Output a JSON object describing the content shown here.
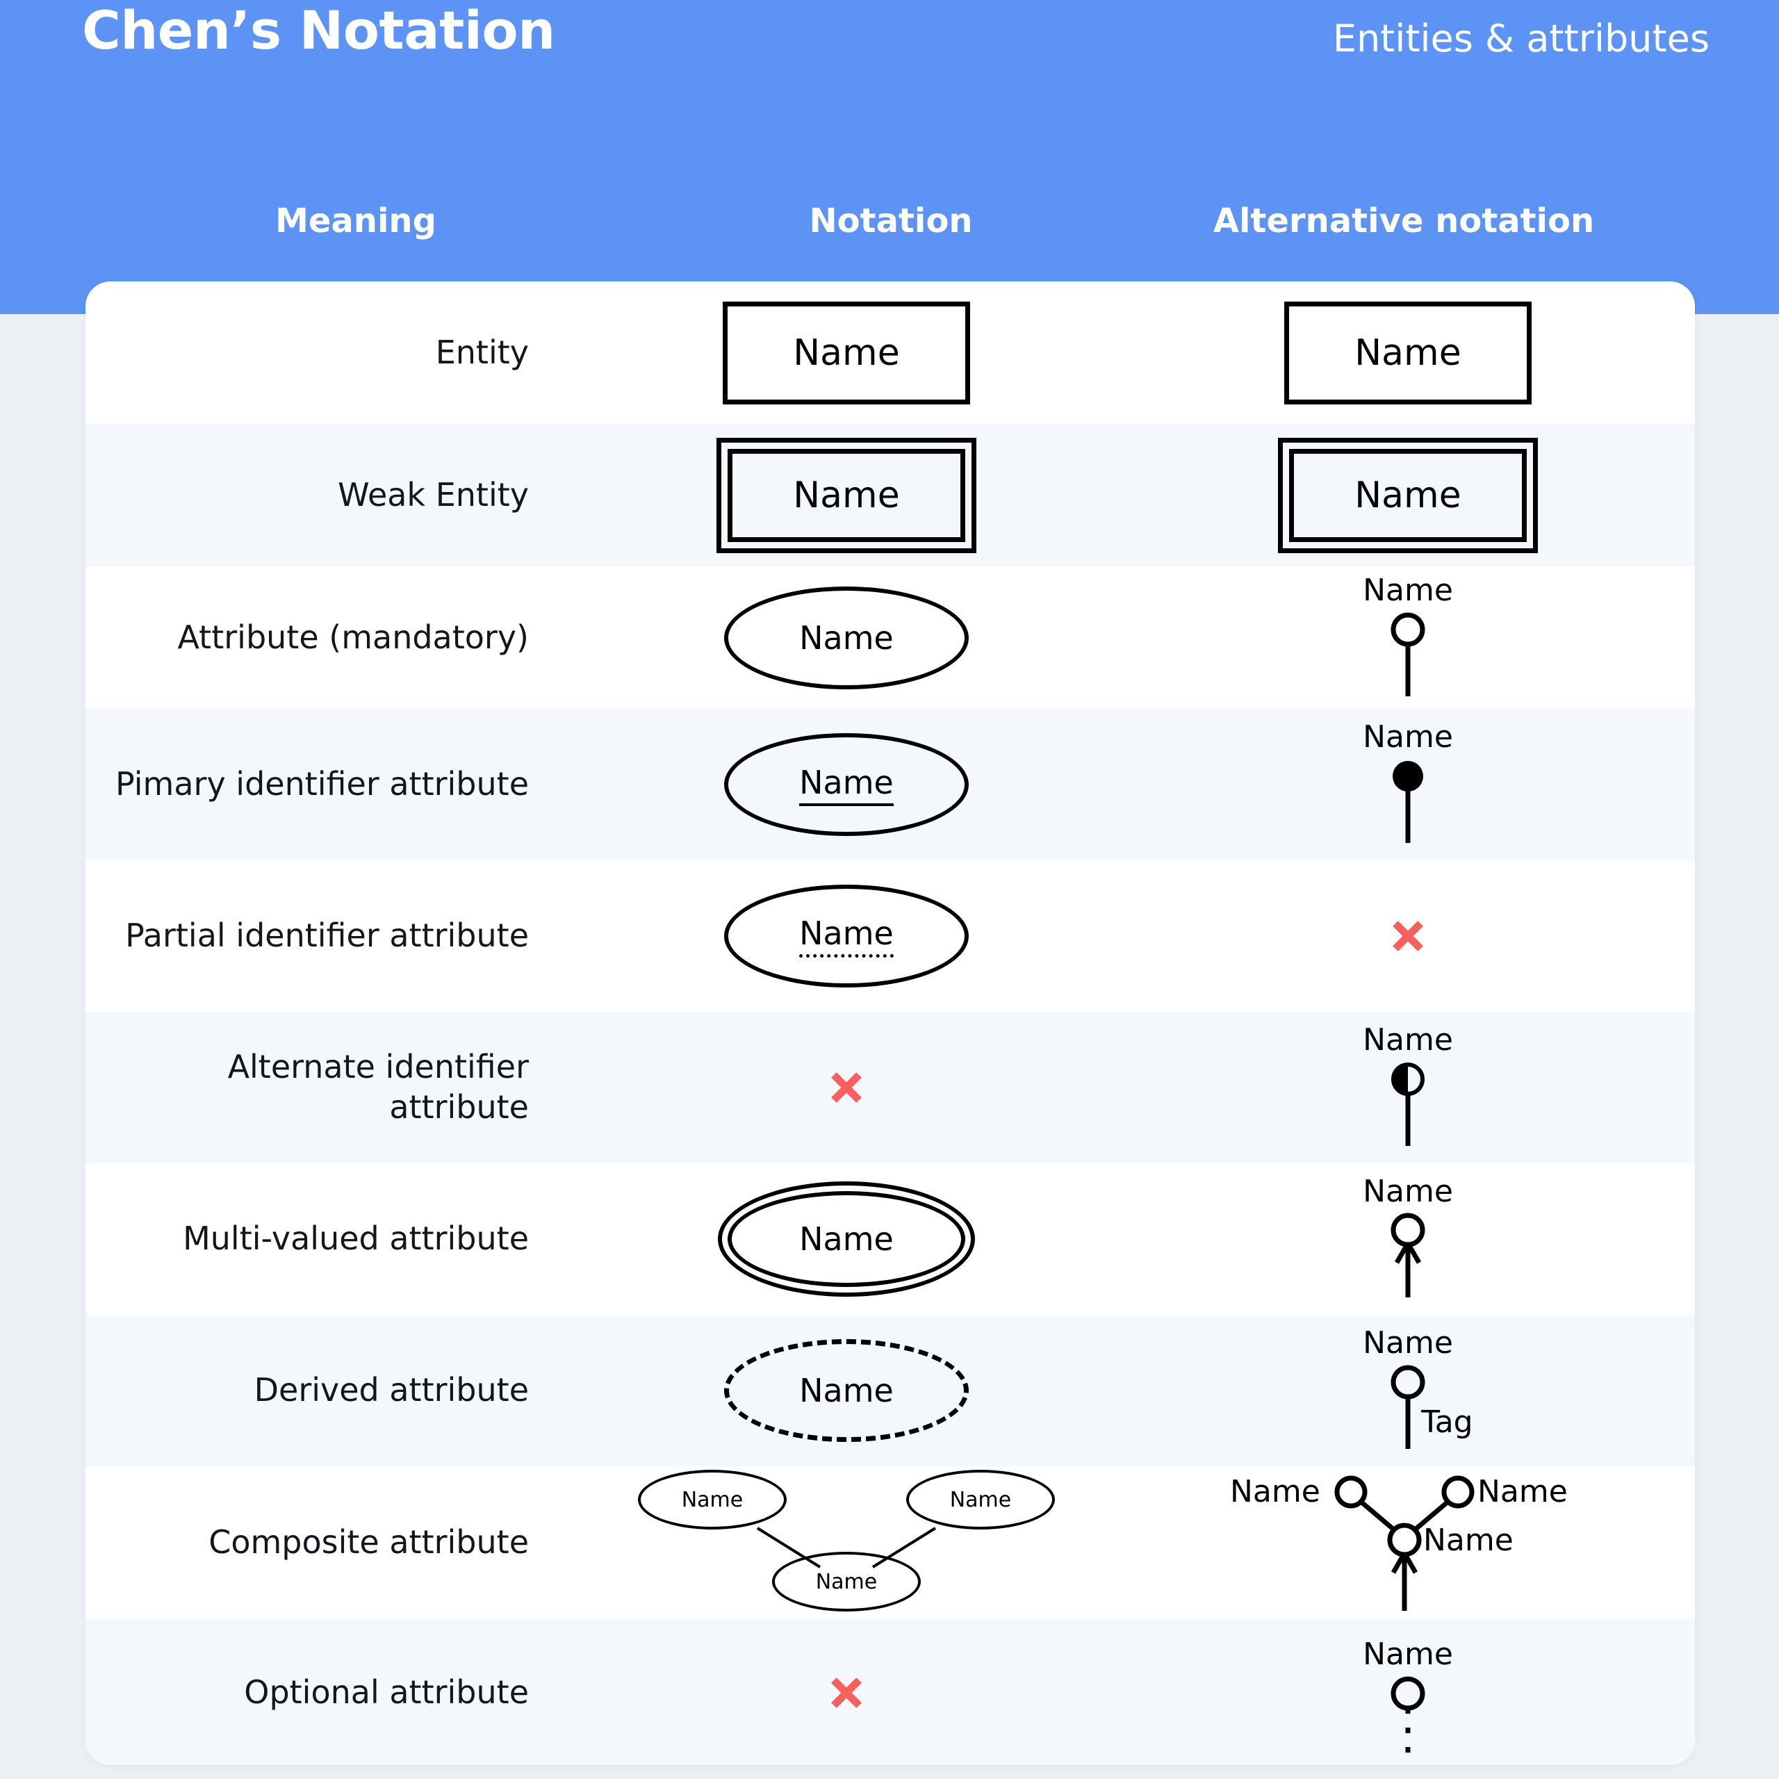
{
  "header": {
    "title": "Chen’s Notation",
    "subtitle": "Entities & attributes",
    "accent_color": "#5C93F5",
    "columns": {
      "meaning": "Meaning",
      "notation": "Notation",
      "alternative": "Alternative notation"
    }
  },
  "palette": {
    "header_blue": "#5C93F5",
    "page_bg": "#ECEFF3",
    "card_bg": "#FFFFFF",
    "row_alt_bg": "#F4F7FC",
    "x_mark_red": "#F85F5F",
    "ink": "#000000"
  },
  "common": {
    "name_label": "Name",
    "tag_label": "Tag",
    "not_available_icon": "x-mark-icon"
  },
  "rows": [
    {
      "meaning": "Entity",
      "notation": {
        "kind": "rectangle",
        "label": "Name"
      },
      "alternative": {
        "kind": "rectangle",
        "label": "Name"
      }
    },
    {
      "meaning": "Weak Entity",
      "notation": {
        "kind": "double-rectangle",
        "label": "Name"
      },
      "alternative": {
        "kind": "double-rectangle",
        "label": "Name"
      }
    },
    {
      "meaning": "Attribute (mandatory)",
      "notation": {
        "kind": "ellipse",
        "label": "Name"
      },
      "alternative": {
        "kind": "pin-hollow-circle",
        "label": "Name"
      }
    },
    {
      "meaning": "Pimary identifier attribute",
      "notation": {
        "kind": "ellipse-underline-solid",
        "label": "Name"
      },
      "alternative": {
        "kind": "pin-filled-circle",
        "label": "Name"
      }
    },
    {
      "meaning": "Partial identifier attribute",
      "notation": {
        "kind": "ellipse-underline-dotted",
        "label": "Name"
      },
      "alternative": {
        "kind": "none",
        "label": ""
      }
    },
    {
      "meaning": "Alternate identifier attribute",
      "notation": {
        "kind": "none",
        "label": ""
      },
      "alternative": {
        "kind": "pin-half-filled-circle",
        "label": "Name"
      }
    },
    {
      "meaning": "Multi-valued attribute",
      "notation": {
        "kind": "double-ellipse",
        "label": "Name"
      },
      "alternative": {
        "kind": "pin-hollow-circle-arrow",
        "label": "Name"
      }
    },
    {
      "meaning": "Derived attribute",
      "notation": {
        "kind": "dashed-ellipse",
        "label": "Name"
      },
      "alternative": {
        "kind": "pin-hollow-circle-tag",
        "label": "Name",
        "tag": "Tag"
      }
    },
    {
      "meaning": "Composite attribute",
      "notation": {
        "kind": "composite-ellipses",
        "top_left_label": "Name",
        "top_right_label": "Name",
        "bottom_label": "Name"
      },
      "alternative": {
        "kind": "composite-circles",
        "left_label": "Name",
        "right_label": "Name",
        "center_label": "Name"
      }
    },
    {
      "meaning": "Optional attribute",
      "notation": {
        "kind": "none",
        "label": ""
      },
      "alternative": {
        "kind": "pin-hollow-circle-dotted-stem",
        "label": "Name"
      }
    }
  ]
}
